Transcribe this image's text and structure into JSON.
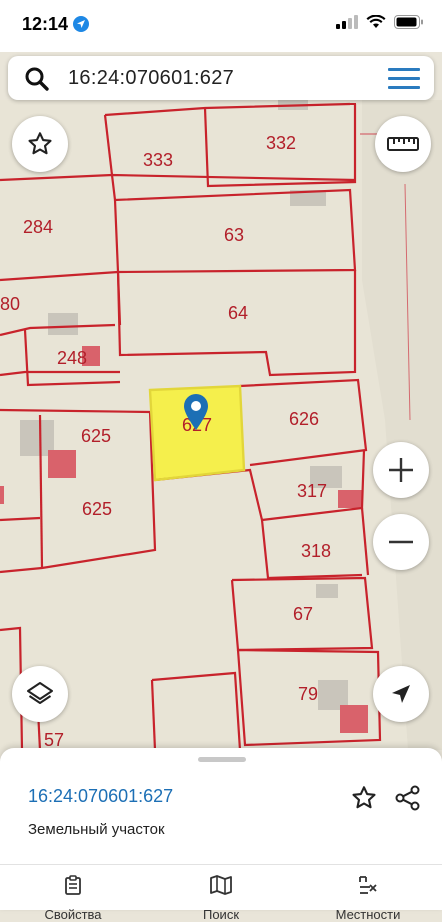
{
  "status": {
    "time": "12:14"
  },
  "search": {
    "query": "16:24:070601:627"
  },
  "map": {
    "parcels": [
      "333",
      "332",
      "284",
      "63",
      "80",
      "64",
      "248",
      "625",
      "627",
      "626",
      "317",
      "625",
      "318",
      "67",
      "79",
      "57"
    ],
    "selected_parcel": "627",
    "highlight_color": "#f6ef3d",
    "border_color": "#c8232c"
  },
  "panel": {
    "cadastral_number": "16:24:070601:627",
    "type": "Земельный участок"
  },
  "tabs": [
    {
      "label": "Свойства"
    },
    {
      "label": "Поиск"
    },
    {
      "label": "Местности"
    }
  ]
}
